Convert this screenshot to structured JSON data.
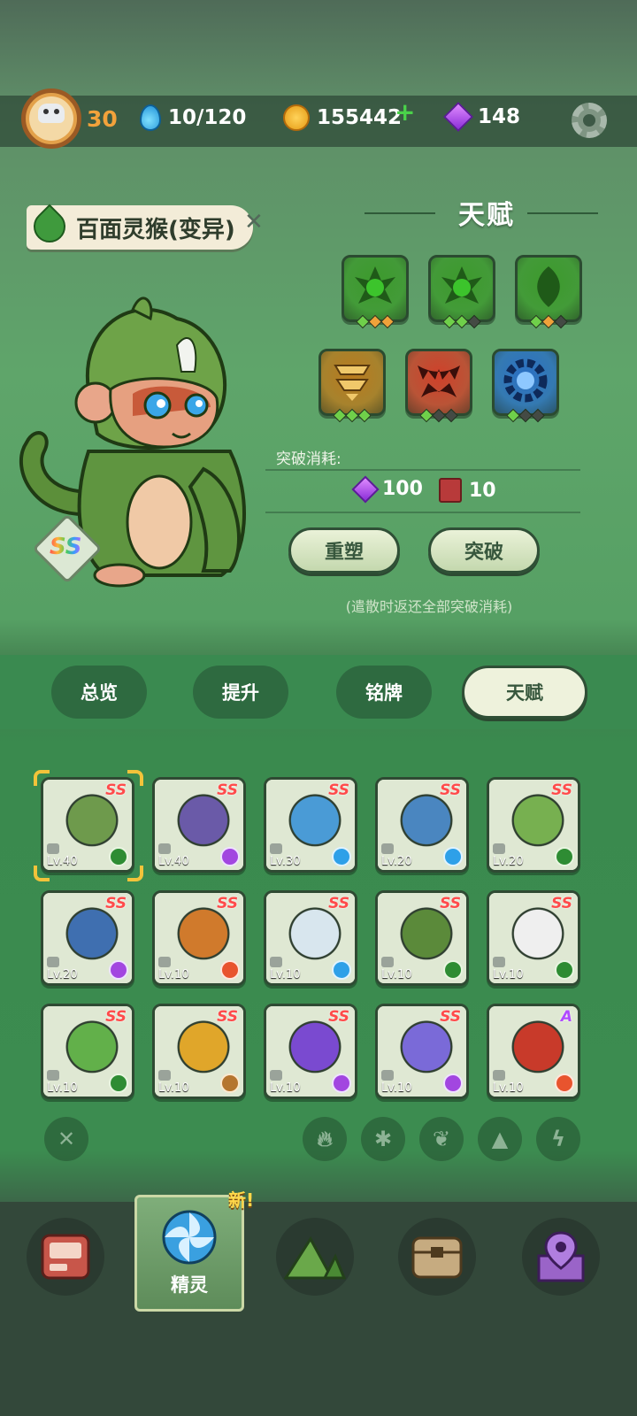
{
  "player": {
    "level": "30"
  },
  "resources": {
    "energy": "10/120",
    "coins": "155442",
    "gems": "148"
  },
  "creature": {
    "name": "百面灵猴(变异)",
    "rank": "SS"
  },
  "talent": {
    "title": "天赋",
    "skills_row1": [
      {
        "icon": "spiky-leaf-icon",
        "color": "#3c9a2c",
        "pips": [
          "#6fd04a",
          "#f0a23a",
          "#f0a23a"
        ]
      },
      {
        "icon": "spiky-leaf-icon",
        "color": "#3c9a2c",
        "pips": [
          "#6fd04a",
          "#6fd04a",
          "#444a44"
        ]
      },
      {
        "icon": "leaf-drop-icon",
        "color": "#3c9a2c",
        "pips": [
          "#6fd04a",
          "#f0a23a",
          "#444a44"
        ]
      }
    ],
    "skills_row2": [
      {
        "icon": "shield-stack-icon",
        "color": "#b97a1e",
        "pips": [
          "#6fd04a",
          "#6fd04a",
          "#6fd04a"
        ]
      },
      {
        "icon": "fang-icon",
        "color": "#d0402a",
        "pips": [
          "#6fd04a",
          "#444a44",
          "#444a44"
        ]
      },
      {
        "icon": "gear-ring-icon",
        "color": "#2a6fc4",
        "pips": [
          "#6fd04a",
          "#444a44",
          "#444a44"
        ]
      }
    ],
    "cost_label": "突破消耗:",
    "cost_gems": "100",
    "cost_books": "10",
    "reshape_button": "重塑",
    "breakthrough_button": "突破",
    "note": "(遣散时返还全部突破消耗)"
  },
  "tabs": [
    "总览",
    "提升",
    "铭牌",
    "天赋"
  ],
  "creatures": [
    {
      "rank": "SS",
      "level": "Lv.40",
      "element": "grass",
      "color": "#6e9a4c",
      "selected": true
    },
    {
      "rank": "SS",
      "level": "Lv.40",
      "element": "elec",
      "color": "#6a5aa8"
    },
    {
      "rank": "SS",
      "level": "Lv.30",
      "element": "ice",
      "color": "#4a9bd6"
    },
    {
      "rank": "SS",
      "level": "Lv.20",
      "element": "ice",
      "color": "#4a86c0"
    },
    {
      "rank": "SS",
      "level": "Lv.20",
      "element": "grass",
      "color": "#77b050"
    },
    {
      "rank": "SS",
      "level": "Lv.20",
      "element": "elec",
      "color": "#3f6fb0"
    },
    {
      "rank": "SS",
      "level": "Lv.10",
      "element": "fire",
      "color": "#d07a2c"
    },
    {
      "rank": "SS",
      "level": "Lv.10",
      "element": "ice",
      "color": "#d8e6ee"
    },
    {
      "rank": "SS",
      "level": "Lv.10",
      "element": "grass",
      "color": "#5b8a3a"
    },
    {
      "rank": "SS",
      "level": "Lv.10",
      "element": "grass",
      "color": "#efefef"
    },
    {
      "rank": "SS",
      "level": "Lv.10",
      "element": "grass",
      "color": "#62b04a"
    },
    {
      "rank": "SS",
      "level": "Lv.10",
      "element": "earth",
      "color": "#e0a62a"
    },
    {
      "rank": "SS",
      "level": "Lv.10",
      "element": "elec",
      "color": "#7a4ad0"
    },
    {
      "rank": "SS",
      "level": "Lv.10",
      "element": "elec",
      "color": "#7a6ad8"
    },
    {
      "rank": "A",
      "level": "Lv.10",
      "element": "fire",
      "color": "#c83a2a"
    }
  ],
  "filters": [
    "clear-filter-icon",
    "fire-icon",
    "ice-icon",
    "grass-icon",
    "earth-icon",
    "electric-icon"
  ],
  "bottom_nav": {
    "new_badge": "新!",
    "active_label": "精灵",
    "items": [
      "device-icon",
      "spirit-icon",
      "mountain-icon",
      "chest-icon",
      "map-pin-icon"
    ]
  }
}
